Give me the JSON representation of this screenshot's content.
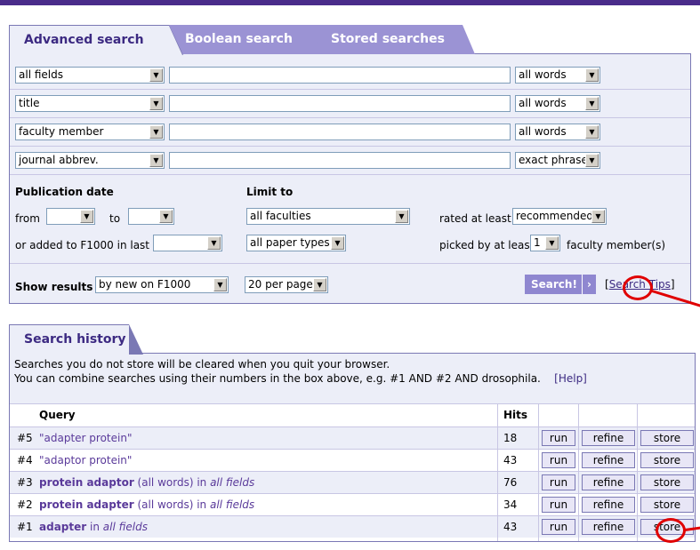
{
  "tabs": [
    {
      "label": "Advanced search",
      "active": true
    },
    {
      "label": "Boolean search",
      "active": false
    },
    {
      "label": "Stored searches",
      "active": false
    }
  ],
  "search_rows": [
    {
      "field": "all fields",
      "value": "",
      "mode": "all words"
    },
    {
      "field": "title",
      "value": "",
      "mode": "all words"
    },
    {
      "field": "faculty member",
      "value": "",
      "mode": "all words"
    },
    {
      "field": "journal abbrev.",
      "value": "",
      "mode": "exact phrase"
    }
  ],
  "filters": {
    "pub_date_label": "Publication date",
    "from_label": "from",
    "to_label": "to",
    "from_value": "",
    "to_value": "",
    "added_label": "or added to F1000 in last",
    "added_value": "",
    "limit_label": "Limit to",
    "faculties": "all faculties",
    "paper_types": "all paper types",
    "rated_label": "rated at least",
    "rated_value": "recommended",
    "picked_label": "picked by at least",
    "picked_value": "1",
    "picked_suffix": "faculty member(s)"
  },
  "results": {
    "show_label": "Show results",
    "order": "by new on F1000",
    "per_page": "20 per page",
    "search_button": "Search!",
    "search_button_icon": "chevron-right",
    "tips_open": "[",
    "tips_link": "Search Tips",
    "tips_close": "]"
  },
  "history": {
    "tab_label": "Search history",
    "info_line1": "Searches you do not store will be cleared when you quit your browser.",
    "info_line2": "You can combine searches using their numbers in the box above, e.g. #1 AND #2 AND drosophila.",
    "help_link": "[Help]",
    "col_query": "Query",
    "col_hits": "Hits",
    "btn_run": "run",
    "btn_refine": "refine",
    "btn_store": "store",
    "rows": [
      {
        "num": "#5",
        "term": "",
        "quoted": "\"adapter protein\"",
        "mode": "",
        "in": "",
        "field": "",
        "hits": "18"
      },
      {
        "num": "#4",
        "term": "",
        "quoted": "\"adaptor protein\"",
        "mode": "",
        "in": "",
        "field": "",
        "hits": "43"
      },
      {
        "num": "#3",
        "term": "protein adaptor",
        "quoted": "",
        "mode": " (all words) ",
        "in": "in ",
        "field": "all fields",
        "hits": "76"
      },
      {
        "num": "#2",
        "term": "protein adapter",
        "quoted": "",
        "mode": " (all words) ",
        "in": "in ",
        "field": "all fields",
        "hits": "34"
      },
      {
        "num": "#1",
        "term": "adapter",
        "quoted": "",
        "mode": " ",
        "in": "in ",
        "field": "all fields",
        "hits": "43"
      }
    ]
  },
  "colors": {
    "brand": "#4a2c8a",
    "panel": "#eceef8",
    "tab_inactive": "#9b93d4",
    "annotation": "#e00000"
  }
}
